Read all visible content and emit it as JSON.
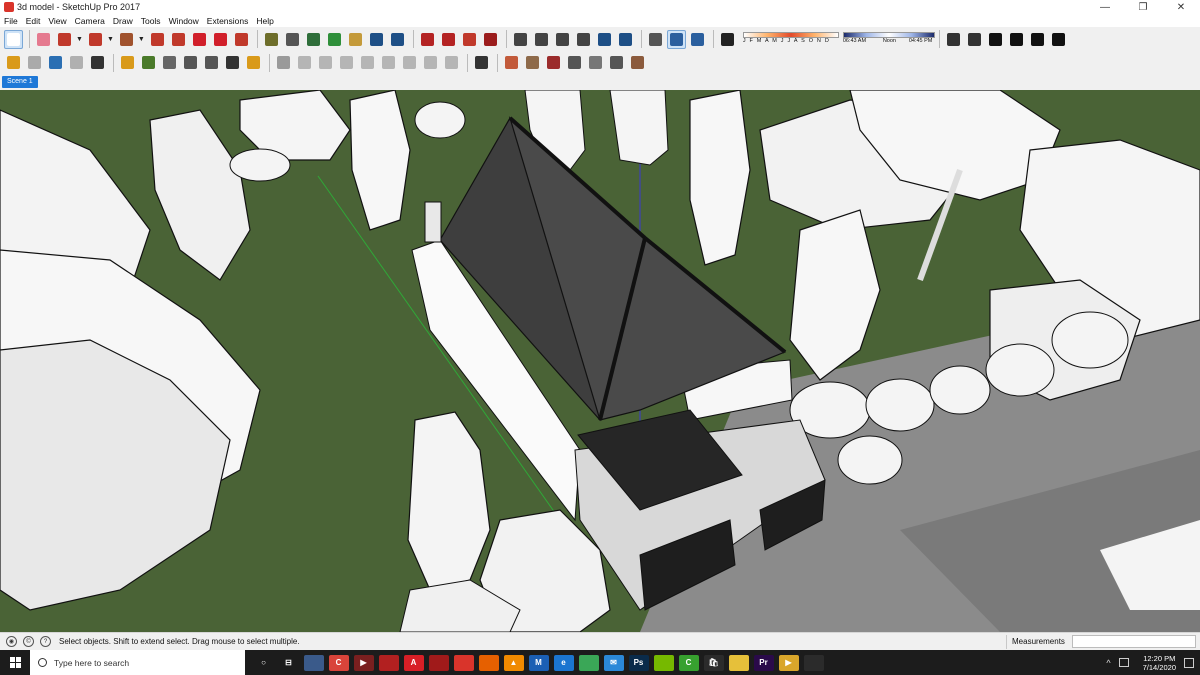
{
  "window": {
    "title": "3d model - SketchUp Pro 2017",
    "minimize": "—",
    "restore": "❐",
    "close": "✕"
  },
  "menu": [
    "File",
    "Edit",
    "View",
    "Camera",
    "Draw",
    "Tools",
    "Window",
    "Extensions",
    "Help"
  ],
  "toolbar1": {
    "icons": [
      {
        "name": "select-icon",
        "color": "#ffffff",
        "active": true
      },
      {
        "name": "eraser-icon",
        "color": "#e57a8f"
      },
      {
        "name": "line-pencil-icon",
        "color": "#c0392b",
        "caret": true
      },
      {
        "name": "arc-icon",
        "color": "#c0392b",
        "caret": true
      },
      {
        "name": "rectangle-icon",
        "color": "#a0522d",
        "caret": true
      },
      {
        "name": "push-pull-icon",
        "color": "#c0392b"
      },
      {
        "name": "follow-me-icon",
        "color": "#c0392b"
      },
      {
        "name": "move-icon",
        "color": "#d11f2a"
      },
      {
        "name": "rotate-icon",
        "color": "#d11f2a"
      },
      {
        "name": "scale-icon",
        "color": "#c0392b"
      },
      {
        "name": "tape-measure-icon",
        "color": "#6d6d2a"
      },
      {
        "name": "text-icon",
        "color": "#555555"
      },
      {
        "name": "paint-bucket-icon",
        "color": "#2f6e3a"
      },
      {
        "name": "orbit-icon",
        "color": "#2f8f3a"
      },
      {
        "name": "pan-icon",
        "color": "#c49a3a"
      },
      {
        "name": "zoom-icon",
        "color": "#1e4f86"
      },
      {
        "name": "zoom-extents-icon",
        "color": "#1e4f86"
      },
      {
        "name": "warehouse-icon",
        "color": "#b42323"
      },
      {
        "name": "share-model-icon",
        "color": "#b42323"
      },
      {
        "name": "components-icon",
        "color": "#c0392b"
      },
      {
        "name": "extension-warehouse-icon",
        "color": "#9b1c1c"
      },
      {
        "name": "iso-view-icon",
        "color": "#444444"
      },
      {
        "name": "top-view-icon",
        "color": "#444444"
      },
      {
        "name": "front-view-icon",
        "color": "#444444"
      },
      {
        "name": "right-view-icon",
        "color": "#444444"
      },
      {
        "name": "back-view-icon",
        "color": "#1e4f86"
      },
      {
        "name": "left-view-icon",
        "color": "#1e4f86"
      },
      {
        "name": "axes-icon",
        "color": "#555555"
      },
      {
        "name": "section-plane-icon",
        "color": "#2b5f9e",
        "active": true
      },
      {
        "name": "section-display-icon",
        "color": "#2b5f9e"
      },
      {
        "name": "shadow-toggle-icon",
        "color": "#222222"
      }
    ],
    "shadow_months": "J F M A M J J A S O N D",
    "shadow_times": {
      "start": "06:43 AM",
      "mid": "Noon",
      "end": "04:45 PM"
    },
    "view_icons": [
      {
        "name": "styles-xray-icon",
        "color": "#333333"
      },
      {
        "name": "back-edges-icon",
        "color": "#333333"
      },
      {
        "name": "wireframe-home-icon",
        "color": "#111111"
      },
      {
        "name": "hidden-line-icon",
        "color": "#111111"
      },
      {
        "name": "home-outline-icon",
        "color": "#111111"
      },
      {
        "name": "shaded-icon",
        "color": "#111111"
      }
    ]
  },
  "toolbar2": {
    "icons": [
      {
        "name": "sandbox-icon",
        "color": "#d99a1a"
      },
      {
        "name": "refresh-icon",
        "color": "#aaaaaa"
      },
      {
        "name": "print-icon",
        "color": "#2b6fb3"
      },
      {
        "name": "export-icon",
        "color": "#b0b0b0"
      },
      {
        "name": "layers-icon",
        "color": "#333333"
      },
      {
        "name": "solid-tools-icon",
        "color": "#d99a1a"
      },
      {
        "name": "terrain-icon",
        "color": "#4a7a2a"
      },
      {
        "name": "camera-icon",
        "color": "#666666"
      },
      {
        "name": "sound-icon",
        "color": "#555555"
      },
      {
        "name": "list-settings-icon",
        "color": "#555555"
      },
      {
        "name": "chat-icon",
        "color": "#333333"
      },
      {
        "name": "info-icon",
        "color": "#d99a1a"
      },
      {
        "name": "dim-icon-1",
        "color": "#9a9a9a"
      },
      {
        "name": "dim-icon-2",
        "color": "#b5b5b5"
      },
      {
        "name": "dim-icon-3",
        "color": "#b5b5b5"
      },
      {
        "name": "dim-icon-4",
        "color": "#b5b5b5"
      },
      {
        "name": "dim-icon-5",
        "color": "#b5b5b5"
      },
      {
        "name": "dim-icon-6",
        "color": "#b5b5b5"
      },
      {
        "name": "dim-icon-7",
        "color": "#b5b5b5"
      },
      {
        "name": "dim-icon-8",
        "color": "#b5b5b5"
      },
      {
        "name": "dim-icon-9",
        "color": "#b5b5b5"
      },
      {
        "name": "globe-icon",
        "color": "#333333"
      },
      {
        "name": "geo-location-icon",
        "color": "#c25a3a"
      },
      {
        "name": "photo-texture-icon",
        "color": "#8e6a4a"
      },
      {
        "name": "add-location-icon",
        "color": "#9b2b2b"
      },
      {
        "name": "terrain-toggle-icon",
        "color": "#555555"
      },
      {
        "name": "hand-icon",
        "color": "#777777"
      },
      {
        "name": "stamp-icon",
        "color": "#555555"
      },
      {
        "name": "drape-icon",
        "color": "#8b5a3c"
      }
    ]
  },
  "scene": {
    "tab": "Scene 1"
  },
  "status": {
    "message": "Select objects. Shift to extend select. Drag mouse to select multiple.",
    "measurements_label": "Measurements",
    "measurements_value": ""
  },
  "taskbar": {
    "search_placeholder": "Type here to search",
    "apps": [
      {
        "name": "cortana-icon",
        "color": "#1c1c1c",
        "glyph": "○"
      },
      {
        "name": "task-view-icon",
        "color": "#1c1c1c",
        "glyph": "⊟"
      },
      {
        "name": "camera-app-icon",
        "color": "#3a5a8a",
        "glyph": ""
      },
      {
        "name": "ccleaner-icon",
        "color": "#d9443a",
        "glyph": "C"
      },
      {
        "name": "video-app-icon",
        "color": "#7a1f1f",
        "glyph": "▶"
      },
      {
        "name": "pdf-tool-icon",
        "color": "#b22020",
        "glyph": ""
      },
      {
        "name": "acrobat-icon",
        "color": "#d81f26",
        "glyph": "A"
      },
      {
        "name": "red-app-icon",
        "color": "#a01a1a",
        "glyph": ""
      },
      {
        "name": "sketchup-task-icon",
        "color": "#d9342b",
        "glyph": ""
      },
      {
        "name": "firefox-icon",
        "color": "#e66000",
        "glyph": ""
      },
      {
        "name": "vlc-icon",
        "color": "#f08a00",
        "glyph": "▲"
      },
      {
        "name": "malwarebytes-icon",
        "color": "#1b5fb4",
        "glyph": "M"
      },
      {
        "name": "edge-icon",
        "color": "#1b75d0",
        "glyph": "e"
      },
      {
        "name": "chrome-icon",
        "color": "#3aa757",
        "glyph": ""
      },
      {
        "name": "mail-icon",
        "color": "#2b88d8",
        "glyph": "✉"
      },
      {
        "name": "photoshop-icon",
        "color": "#0a2b4a",
        "glyph": "Ps"
      },
      {
        "name": "nvidia-icon",
        "color": "#76b900",
        "glyph": ""
      },
      {
        "name": "camtasia-icon",
        "color": "#37a12f",
        "glyph": "C"
      },
      {
        "name": "store-icon",
        "color": "#2b2b2b",
        "glyph": "🛍"
      },
      {
        "name": "files-icon",
        "color": "#e6c03a",
        "glyph": ""
      },
      {
        "name": "premiere-icon",
        "color": "#2a0a4a",
        "glyph": "Pr"
      },
      {
        "name": "media-player-icon",
        "color": "#d9a62b",
        "glyph": "▶"
      },
      {
        "name": "paint-icon",
        "color": "#2b2b2b",
        "glyph": ""
      }
    ],
    "time": "12:20 PM",
    "date": "7/14/2020"
  }
}
